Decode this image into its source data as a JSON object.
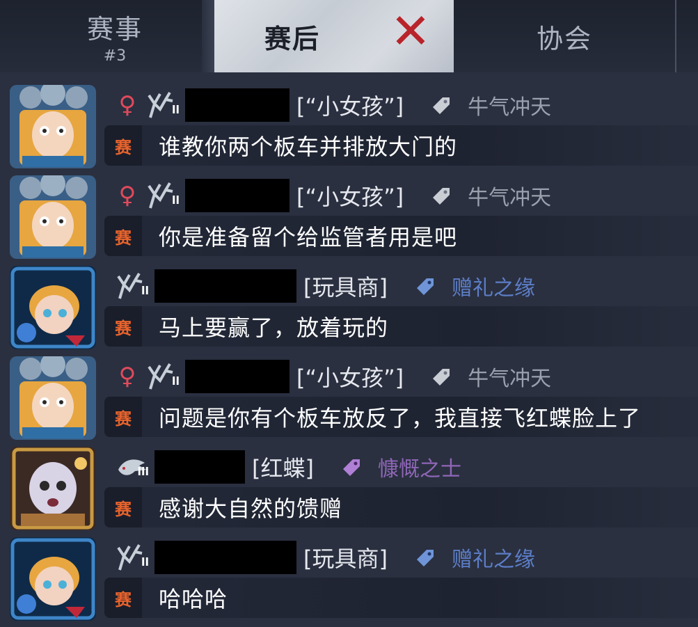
{
  "tabs": {
    "match": {
      "label": "赛事",
      "sub": "#3"
    },
    "after": {
      "label": "赛后"
    },
    "association": {
      "label": "协会"
    }
  },
  "badge_label": "赛",
  "colors": {
    "gender": "#e04a5c",
    "badge": "#e8632c",
    "title_gray": "#9aa0ad",
    "title_blue": "#5d7ec8",
    "title_purple": "#9066b8",
    "close_mark": "#b8242a"
  },
  "messages": [
    {
      "avatar": "little-girl-avatar",
      "gender": "♀",
      "role": "[“小女孩”]",
      "tag_icon": "gray-tag-icon",
      "title": "牛气冲天",
      "text": "谁教你两个板车并排放大门的"
    },
    {
      "avatar": "little-girl-avatar",
      "gender": "♀",
      "role": "[“小女孩”]",
      "tag_icon": "gray-tag-icon",
      "title": "牛气冲天",
      "text": "你是准备留个给监管者用是吧"
    },
    {
      "avatar": "toy-merchant-avatar",
      "gender": "",
      "role": "[玩具商]",
      "tag_icon": "blue-tag-icon",
      "title": "赠礼之缘",
      "text": "马上要赢了，放着玩的"
    },
    {
      "avatar": "little-girl-avatar",
      "gender": "♀",
      "role": "[“小女孩”]",
      "tag_icon": "gray-tag-icon",
      "title": "牛气冲天",
      "text": "问题是你有个板车放反了，我直接飞红蝶脸上了"
    },
    {
      "avatar": "red-butterfly-avatar",
      "gender": "",
      "role": "[红蝶]",
      "tag_icon": "purple-tag-icon",
      "title": "慷慨之士",
      "text": "感谢大自然的馈赠"
    },
    {
      "avatar": "toy-merchant-avatar",
      "gender": "",
      "role": "[玩具商]",
      "tag_icon": "blue-tag-icon",
      "title": "赠礼之缘",
      "text": "哈哈哈"
    }
  ]
}
